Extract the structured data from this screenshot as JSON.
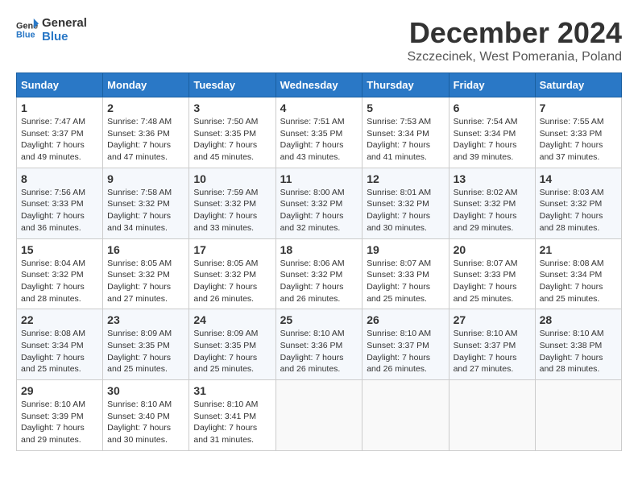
{
  "logo": {
    "line1": "General",
    "line2": "Blue"
  },
  "title": "December 2024",
  "subtitle": "Szczecinek, West Pomerania, Poland",
  "days_of_week": [
    "Sunday",
    "Monday",
    "Tuesday",
    "Wednesday",
    "Thursday",
    "Friday",
    "Saturday"
  ],
  "weeks": [
    [
      {
        "day": "1",
        "sunrise": "Sunrise: 7:47 AM",
        "sunset": "Sunset: 3:37 PM",
        "daylight": "Daylight: 7 hours and 49 minutes."
      },
      {
        "day": "2",
        "sunrise": "Sunrise: 7:48 AM",
        "sunset": "Sunset: 3:36 PM",
        "daylight": "Daylight: 7 hours and 47 minutes."
      },
      {
        "day": "3",
        "sunrise": "Sunrise: 7:50 AM",
        "sunset": "Sunset: 3:35 PM",
        "daylight": "Daylight: 7 hours and 45 minutes."
      },
      {
        "day": "4",
        "sunrise": "Sunrise: 7:51 AM",
        "sunset": "Sunset: 3:35 PM",
        "daylight": "Daylight: 7 hours and 43 minutes."
      },
      {
        "day": "5",
        "sunrise": "Sunrise: 7:53 AM",
        "sunset": "Sunset: 3:34 PM",
        "daylight": "Daylight: 7 hours and 41 minutes."
      },
      {
        "day": "6",
        "sunrise": "Sunrise: 7:54 AM",
        "sunset": "Sunset: 3:34 PM",
        "daylight": "Daylight: 7 hours and 39 minutes."
      },
      {
        "day": "7",
        "sunrise": "Sunrise: 7:55 AM",
        "sunset": "Sunset: 3:33 PM",
        "daylight": "Daylight: 7 hours and 37 minutes."
      }
    ],
    [
      {
        "day": "8",
        "sunrise": "Sunrise: 7:56 AM",
        "sunset": "Sunset: 3:33 PM",
        "daylight": "Daylight: 7 hours and 36 minutes."
      },
      {
        "day": "9",
        "sunrise": "Sunrise: 7:58 AM",
        "sunset": "Sunset: 3:32 PM",
        "daylight": "Daylight: 7 hours and 34 minutes."
      },
      {
        "day": "10",
        "sunrise": "Sunrise: 7:59 AM",
        "sunset": "Sunset: 3:32 PM",
        "daylight": "Daylight: 7 hours and 33 minutes."
      },
      {
        "day": "11",
        "sunrise": "Sunrise: 8:00 AM",
        "sunset": "Sunset: 3:32 PM",
        "daylight": "Daylight: 7 hours and 32 minutes."
      },
      {
        "day": "12",
        "sunrise": "Sunrise: 8:01 AM",
        "sunset": "Sunset: 3:32 PM",
        "daylight": "Daylight: 7 hours and 30 minutes."
      },
      {
        "day": "13",
        "sunrise": "Sunrise: 8:02 AM",
        "sunset": "Sunset: 3:32 PM",
        "daylight": "Daylight: 7 hours and 29 minutes."
      },
      {
        "day": "14",
        "sunrise": "Sunrise: 8:03 AM",
        "sunset": "Sunset: 3:32 PM",
        "daylight": "Daylight: 7 hours and 28 minutes."
      }
    ],
    [
      {
        "day": "15",
        "sunrise": "Sunrise: 8:04 AM",
        "sunset": "Sunset: 3:32 PM",
        "daylight": "Daylight: 7 hours and 28 minutes."
      },
      {
        "day": "16",
        "sunrise": "Sunrise: 8:05 AM",
        "sunset": "Sunset: 3:32 PM",
        "daylight": "Daylight: 7 hours and 27 minutes."
      },
      {
        "day": "17",
        "sunrise": "Sunrise: 8:05 AM",
        "sunset": "Sunset: 3:32 PM",
        "daylight": "Daylight: 7 hours and 26 minutes."
      },
      {
        "day": "18",
        "sunrise": "Sunrise: 8:06 AM",
        "sunset": "Sunset: 3:32 PM",
        "daylight": "Daylight: 7 hours and 26 minutes."
      },
      {
        "day": "19",
        "sunrise": "Sunrise: 8:07 AM",
        "sunset": "Sunset: 3:33 PM",
        "daylight": "Daylight: 7 hours and 25 minutes."
      },
      {
        "day": "20",
        "sunrise": "Sunrise: 8:07 AM",
        "sunset": "Sunset: 3:33 PM",
        "daylight": "Daylight: 7 hours and 25 minutes."
      },
      {
        "day": "21",
        "sunrise": "Sunrise: 8:08 AM",
        "sunset": "Sunset: 3:34 PM",
        "daylight": "Daylight: 7 hours and 25 minutes."
      }
    ],
    [
      {
        "day": "22",
        "sunrise": "Sunrise: 8:08 AM",
        "sunset": "Sunset: 3:34 PM",
        "daylight": "Daylight: 7 hours and 25 minutes."
      },
      {
        "day": "23",
        "sunrise": "Sunrise: 8:09 AM",
        "sunset": "Sunset: 3:35 PM",
        "daylight": "Daylight: 7 hours and 25 minutes."
      },
      {
        "day": "24",
        "sunrise": "Sunrise: 8:09 AM",
        "sunset": "Sunset: 3:35 PM",
        "daylight": "Daylight: 7 hours and 25 minutes."
      },
      {
        "day": "25",
        "sunrise": "Sunrise: 8:10 AM",
        "sunset": "Sunset: 3:36 PM",
        "daylight": "Daylight: 7 hours and 26 minutes."
      },
      {
        "day": "26",
        "sunrise": "Sunrise: 8:10 AM",
        "sunset": "Sunset: 3:37 PM",
        "daylight": "Daylight: 7 hours and 26 minutes."
      },
      {
        "day": "27",
        "sunrise": "Sunrise: 8:10 AM",
        "sunset": "Sunset: 3:37 PM",
        "daylight": "Daylight: 7 hours and 27 minutes."
      },
      {
        "day": "28",
        "sunrise": "Sunrise: 8:10 AM",
        "sunset": "Sunset: 3:38 PM",
        "daylight": "Daylight: 7 hours and 28 minutes."
      }
    ],
    [
      {
        "day": "29",
        "sunrise": "Sunrise: 8:10 AM",
        "sunset": "Sunset: 3:39 PM",
        "daylight": "Daylight: 7 hours and 29 minutes."
      },
      {
        "day": "30",
        "sunrise": "Sunrise: 8:10 AM",
        "sunset": "Sunset: 3:40 PM",
        "daylight": "Daylight: 7 hours and 30 minutes."
      },
      {
        "day": "31",
        "sunrise": "Sunrise: 8:10 AM",
        "sunset": "Sunset: 3:41 PM",
        "daylight": "Daylight: 7 hours and 31 minutes."
      },
      null,
      null,
      null,
      null
    ]
  ]
}
